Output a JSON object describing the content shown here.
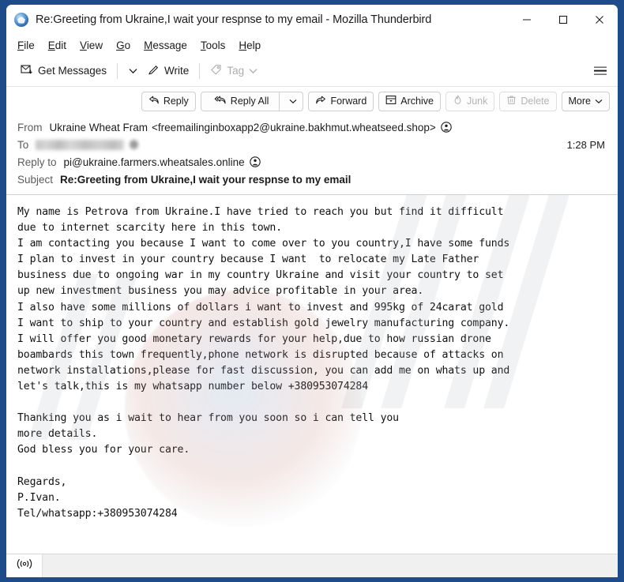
{
  "window": {
    "title": "Re:Greeting from Ukraine,I wait your respnse to my email - Mozilla Thunderbird",
    "app_icon": "thunderbird-icon",
    "minimize_label": "–",
    "maximize_label": "□",
    "close_label": "✕",
    "border_color": "#1e4c8a"
  },
  "menubar": {
    "items": [
      {
        "label": "File",
        "accel": "F"
      },
      {
        "label": "Edit",
        "accel": "E"
      },
      {
        "label": "View",
        "accel": "V"
      },
      {
        "label": "Go",
        "accel": "G"
      },
      {
        "label": "Message",
        "accel": "M"
      },
      {
        "label": "Tools",
        "accel": "T"
      },
      {
        "label": "Help",
        "accel": "H"
      }
    ]
  },
  "main_toolbar": {
    "get_messages_label": "Get Messages",
    "get_messages_caret": "⌄",
    "write_label": "Write",
    "tag_label": "Tag",
    "tag_caret": "⌄",
    "tag_disabled": true,
    "app_menu_label": "app-menu"
  },
  "message_toolbar": {
    "buttons": [
      {
        "name": "reply",
        "label": "Reply",
        "icon": "reply-icon",
        "disabled": false,
        "has_dropdown": false
      },
      {
        "name": "reply-all",
        "label": "Reply All",
        "icon": "reply-all-icon",
        "disabled": false,
        "has_dropdown": true,
        "caret": "⌄"
      },
      {
        "name": "forward",
        "label": "Forward",
        "icon": "forward-icon",
        "disabled": false,
        "has_dropdown": false
      },
      {
        "name": "archive",
        "label": "Archive",
        "icon": "archive-icon",
        "disabled": false,
        "has_dropdown": false
      },
      {
        "name": "junk",
        "label": "Junk",
        "icon": "junk-flame-icon",
        "disabled": true,
        "has_dropdown": false
      },
      {
        "name": "delete",
        "label": "Delete",
        "icon": "trash-icon",
        "disabled": true,
        "has_dropdown": false
      },
      {
        "name": "more",
        "label": "More",
        "icon": "",
        "disabled": false,
        "has_dropdown": true,
        "caret": "⌄"
      }
    ]
  },
  "headers": {
    "from_label": "From",
    "from_name": "Ukraine Wheat Fram",
    "from_address": "<freemailinginboxapp2@ukraine.bakhmut.wheatseed.shop>",
    "to_label": "To",
    "to_value": "",
    "to_redacted": true,
    "time": "1:28 PM",
    "reply_to_label": "Reply to",
    "reply_to_value": "pi@ukraine.farmers.wheatsales.online",
    "subject_label": "Subject",
    "subject_value": "Re:Greeting from Ukraine,I wait your respnse to my email",
    "contact_icon": "contact-circle-icon"
  },
  "message_body": {
    "text": "My name is Petrova from Ukraine.I have tried to reach you but find it difficult\ndue to internet scarcity here in this town.\nI am contacting you because I want to come over to you country,I have some funds\nI plan to invest in your country because I want  to relocate my Late Father\nbusiness due to ongoing war in my country Ukraine and visit your country to set\nup new investment business you may advice profitable in your area.\nI also have some millions of dollars i want to invest and 995kg of 24carat gold\nI want to ship to your country and establish gold jewelry manufacturing company.\nI will offer you good monetary rewards for your help,due to how russian drone\nboambards this town frequently,phone network is disrupted because of attacks on\nnetwork installations,please for fast discussion, you can add me on whats up and\nlet's talk,this is my whatsapp number below +380953074284\n\nThanking you as i wait to hear from you soon so i can tell you\nmore details.\nGod bless you for your care.\n\nRegards,\nP.Ivan.\nTel/whatsapp:+380953074284"
  },
  "status_bar": {
    "connection_icon": "connection-signal-icon",
    "connection_glyph": "((o))",
    "status_text": ""
  }
}
